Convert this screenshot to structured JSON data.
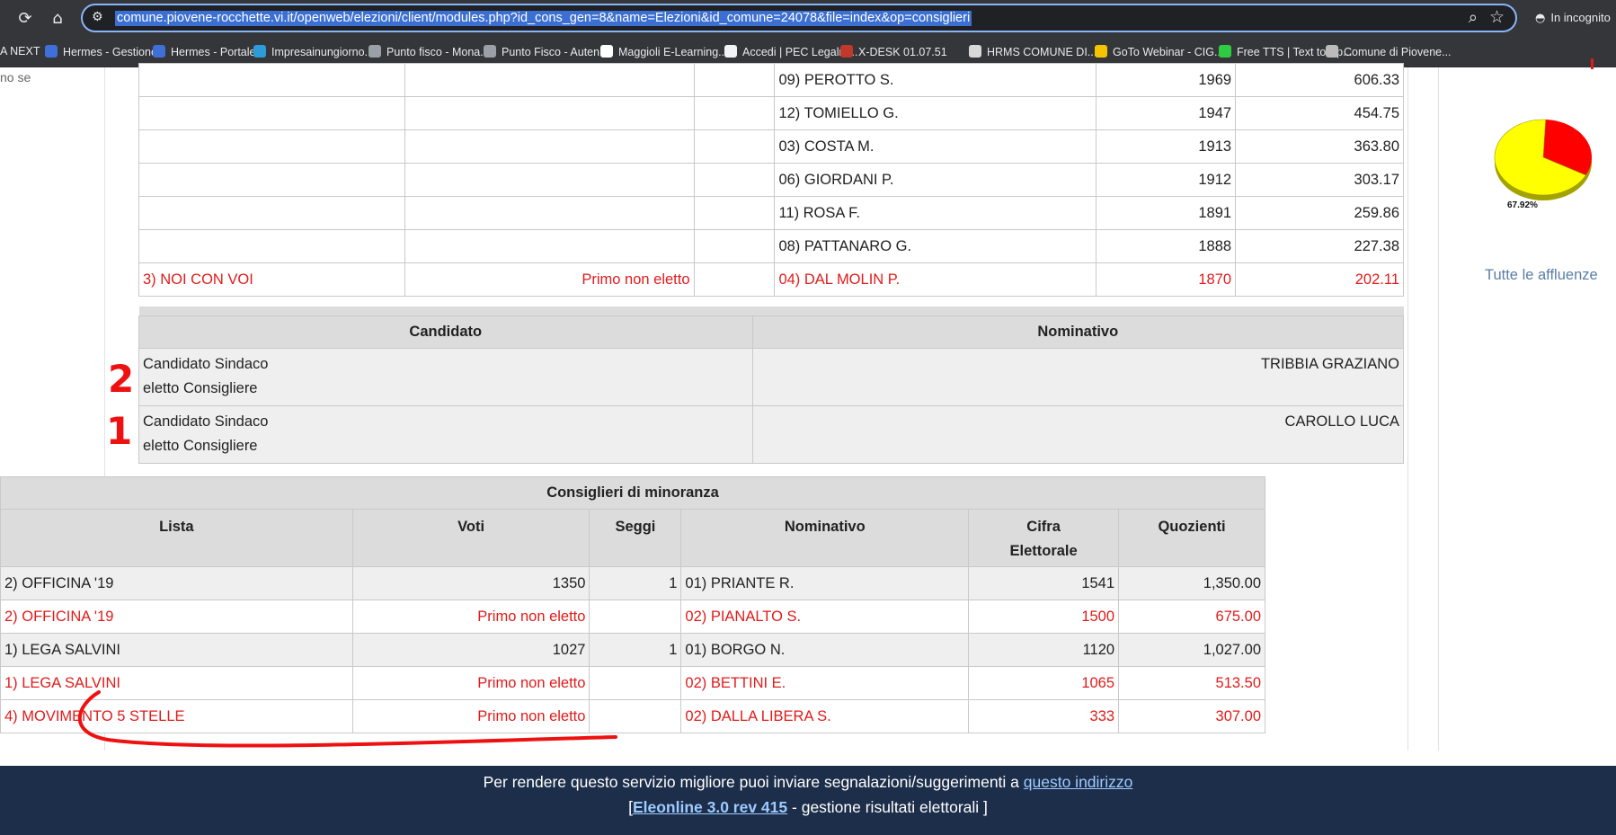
{
  "browser": {
    "url": "comune.piovene-rocchette.vi.it/openweb/elezioni/client/modules.php?id_cons_gen=8&name=Elezioni&id_comune=24078&file=index&op=consiglieri",
    "incognito_label": "In incognito",
    "bookmarks": [
      {
        "label": "A NEXT",
        "color": "#e8eaed"
      },
      {
        "label": "Hermes - Gestione",
        "color": "#3f6fd8"
      },
      {
        "label": "Hermes - Portale",
        "color": "#3f6fd8"
      },
      {
        "label": "Impresainungiorno....",
        "color": "#2d9bd8"
      },
      {
        "label": "Punto fisco - Mona...",
        "color": "#9aa0a6"
      },
      {
        "label": "Punto Fisco - Auten...",
        "color": "#9aa0a6"
      },
      {
        "label": "Maggioli E-Learning...",
        "color": "#ffffff"
      },
      {
        "label": "Accedi | PEC Legalm...",
        "color": "#f1f3f4"
      },
      {
        "label": "X-DESK 01.07.51",
        "color": "#c0392b"
      },
      {
        "label": "HRMS COMUNE DI...",
        "color": "#d9d9d9"
      },
      {
        "label": "GoTo Webinar - CIG...",
        "color": "#f5c400"
      },
      {
        "label": "Free TTS | Text to Sp...",
        "color": "#2ecc40"
      },
      {
        "label": "Comune di Piovene...",
        "color": "#bbbbbb"
      }
    ]
  },
  "page": {
    "left_gutter": "no se",
    "top_rows": [
      {
        "lista": "",
        "voti": "",
        "seggi": "",
        "nominativo": "09) PEROTTO S.",
        "cifra": "1969",
        "quozienti": "606.33",
        "red": false
      },
      {
        "lista": "",
        "voti": "",
        "seggi": "",
        "nominativo": "12) TOMIELLO G.",
        "cifra": "1947",
        "quozienti": "454.75",
        "red": false
      },
      {
        "lista": "",
        "voti": "",
        "seggi": "",
        "nominativo": "03) COSTA M.",
        "cifra": "1913",
        "quozienti": "363.80",
        "red": false
      },
      {
        "lista": "",
        "voti": "",
        "seggi": "",
        "nominativo": "06) GIORDANI P.",
        "cifra": "1912",
        "quozienti": "303.17",
        "red": false
      },
      {
        "lista": "",
        "voti": "",
        "seggi": "",
        "nominativo": "11) ROSA F.",
        "cifra": "1891",
        "quozienti": "259.86",
        "red": false
      },
      {
        "lista": "",
        "voti": "",
        "seggi": "",
        "nominativo": "08) PATTANARO G.",
        "cifra": "1888",
        "quozienti": "227.38",
        "red": false
      },
      {
        "lista": "3) NOI CON VOI",
        "voti": "Primo non eletto",
        "seggi": "",
        "nominativo": "04) DAL MOLIN P.",
        "cifra": "1870",
        "quozienti": "202.11",
        "red": true
      }
    ],
    "candidates": {
      "header_candidato": "Candidato",
      "header_nominativo": "Nominativo",
      "rows": [
        {
          "line1": "Candidato Sindaco",
          "line2": "eletto Consigliere",
          "nominativo": "TRIBBIA GRAZIANO"
        },
        {
          "line1": "Candidato Sindaco",
          "line2": "eletto Consigliere",
          "nominativo": "CAROLLO LUCA"
        }
      ]
    },
    "minority": {
      "title": "Consiglieri di minoranza",
      "headers": {
        "lista": "Lista",
        "voti": "Voti",
        "seggi": "Seggi",
        "nominativo": "Nominativo",
        "cifra_1": "Cifra",
        "cifra_2": "Elettorale",
        "quozienti": "Quozienti"
      },
      "rows": [
        {
          "lista": "2) OFFICINA '19",
          "voti": "1350",
          "seggi": "1",
          "nominativo": "01) PRIANTE R.",
          "cifra": "1541",
          "quozienti": "1,350.00",
          "red": false
        },
        {
          "lista": "2) OFFICINA '19",
          "voti": "Primo non eletto",
          "seggi": "",
          "nominativo": "02) PIANALTO S.",
          "cifra": "1500",
          "quozienti": "675.00",
          "red": true
        },
        {
          "lista": "1) LEGA SALVINI",
          "voti": "1027",
          "seggi": "1",
          "nominativo": "01) BORGO N.",
          "cifra": "1120",
          "quozienti": "1,027.00",
          "red": false
        },
        {
          "lista": "1) LEGA SALVINI",
          "voti": "Primo non eletto",
          "seggi": "",
          "nominativo": "02) BETTINI E.",
          "cifra": "1065",
          "quozienti": "513.50",
          "red": true
        },
        {
          "lista": "4) MOVIMENTO 5 STELLE",
          "voti": "Primo non eletto",
          "seggi": "",
          "nominativo": "02) DALLA LIBERA S.",
          "cifra": "333",
          "quozienti": "307.00",
          "red": true
        }
      ]
    },
    "sidebar": {
      "pie_label": "67.92%",
      "pie_share": 0.6792,
      "pie_colors": {
        "main": "#ffff00",
        "rest": "#ff0000"
      },
      "all_turnout_link": "Tutte le affluenze"
    },
    "annotations": {
      "mark_upper": "2",
      "mark_lower": "1"
    }
  },
  "footer": {
    "line1_text": "Per rendere questo servizio migliore puoi inviare segnalazioni/suggerimenti a",
    "line1_link": "questo indirizzo",
    "line2_open": "[",
    "line2_link": "Eleonline 3.0 rev 415",
    "line2_text": "- gestione risultati elettorali ]"
  }
}
